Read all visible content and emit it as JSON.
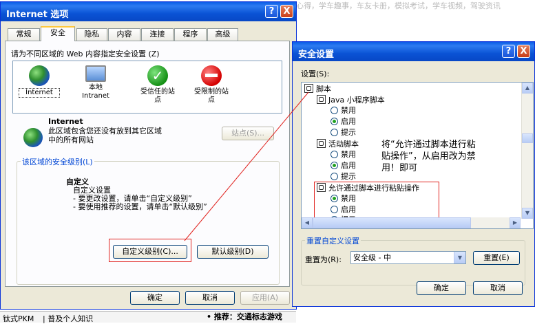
{
  "background": {
    "top_text": "心得，学车趣事，车友卡册，模拟考试，学车视频，驾驶资讯",
    "bottom_left": "钛式PKM",
    "bottom_mid": "| 普及个人知识",
    "bottom_right": "• 推荐：交通标志游戏"
  },
  "internet_options": {
    "title": "Internet 选项",
    "help": "?",
    "close": "X",
    "tabs": [
      "常规",
      "安全",
      "隐私",
      "内容",
      "连接",
      "程序",
      "高级"
    ],
    "instruction": "请为不同区域的 Web 内容指定安全设置 (Z)",
    "zones": [
      {
        "icon": "globe-icon",
        "label": "Internet"
      },
      {
        "icon": "local-intranet-icon",
        "label": "本地\nIntranet"
      },
      {
        "icon": "trusted-sites-icon",
        "label": "受信任的站\n点"
      },
      {
        "icon": "restricted-sites-icon",
        "label": "受限制的站\n点"
      }
    ],
    "zone_name": "Internet",
    "zone_desc": "此区域包含您还没有放到其它区域\n中的所有网站",
    "sites_button": "站点(S)...",
    "security_level_label": "该区域的安全级别(L)",
    "custom_title": "自定义",
    "custom_desc": "自定义设置\n- 要更改设置，请单击“自定义级别”\n- 要使用推荐的设置，请单击“默认级别”",
    "custom_level_button": "自定义级别(C)...",
    "default_level_button": "默认级别(D)",
    "ok": "确定",
    "cancel": "取消",
    "apply": "应用(A)"
  },
  "security_settings": {
    "title": "安全设置",
    "help": "?",
    "close": "X",
    "settings_label": "设置(S):",
    "tree": {
      "scripting": "脚本",
      "java_applet": "Java 小程序脚本",
      "java_opts": [
        "禁用",
        "启用",
        "提示"
      ],
      "active_scripting": "活动脚本",
      "active_opts": [
        "禁用",
        "启用",
        "提示"
      ],
      "paste_via_script": "允许通过脚本进行粘贴操作",
      "paste_opts": [
        "禁用",
        "启用",
        "提示"
      ]
    },
    "annotation": "将“允许通过脚本进行粘\n贴操作”，从启用改为禁\n用！即可",
    "reset_label": "重置自定义设置",
    "reset_to_label": "重置为(R):",
    "reset_value": "安全级 - 中",
    "reset_button": "重置(E)",
    "ok": "确定",
    "cancel": "取消"
  }
}
